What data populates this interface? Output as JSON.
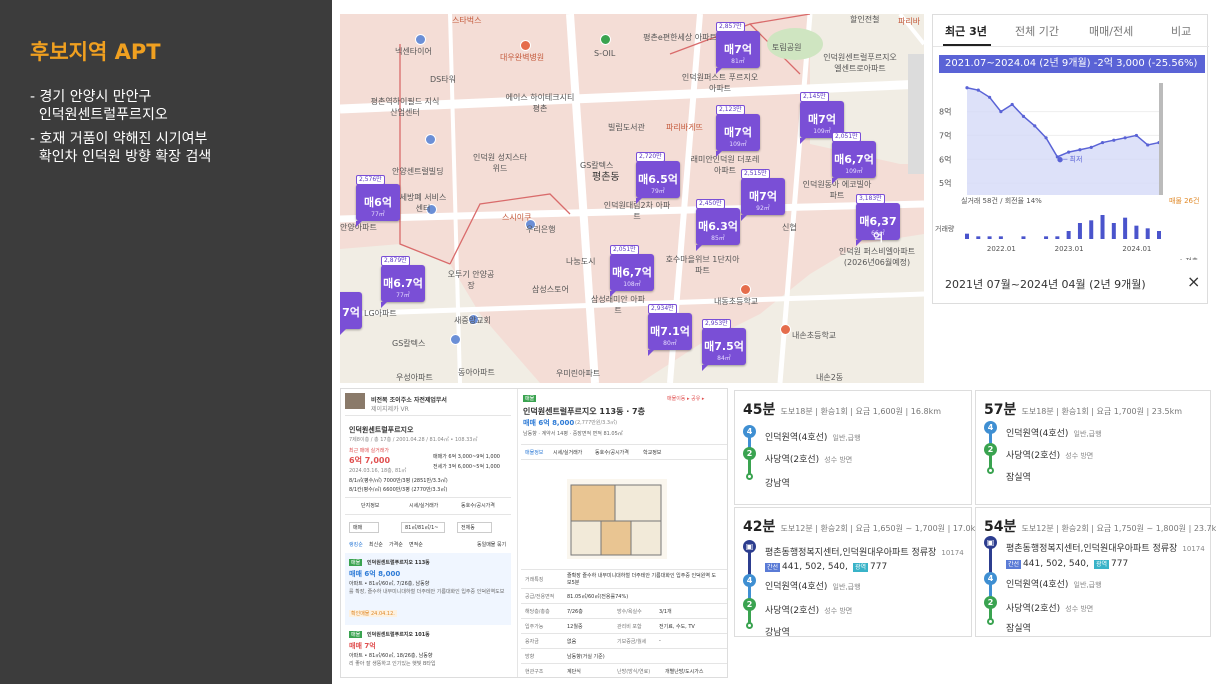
{
  "slide": {
    "title": "후보지역 APT",
    "bullets": [
      "- 경기 안양시 만안구\n  인덕원센트럴푸르지오",
      "- 호재 거품이 약해진 시기여부\n  확인차 인덕원 방향 확장 검색"
    ]
  },
  "map": {
    "labels": [
      {
        "text": "스타벅스"
      },
      {
        "text": "넥센타이어"
      },
      {
        "text": "대우완벽병원"
      },
      {
        "text": "S-OIL"
      },
      {
        "text": "평촌e편한세상 아파트"
      },
      {
        "text": "인덕원센트럴푸르지오 엘센트로아파트"
      },
      {
        "text": "DS타워"
      },
      {
        "text": "평촌역하이필드 지식산업센터"
      },
      {
        "text": "에이스 하이테크시티평촌"
      },
      {
        "text": "인덕원퍼스트 푸르지오아파트"
      },
      {
        "text": "빌립도서관"
      },
      {
        "text": "파리바게뜨"
      },
      {
        "text": "인덕원 성지스타위드"
      },
      {
        "text": "GS칼텍스"
      },
      {
        "text": "안양센트럴빌딩"
      },
      {
        "text": "평촌동"
      },
      {
        "text": "래미안인덕원 더포레아파트"
      },
      {
        "text": "인덕원동아 에코빌아파트"
      },
      {
        "text": "스시이쿠"
      },
      {
        "text": "우리은행"
      },
      {
        "text": "인덕원대림2차 아파트"
      },
      {
        "text": "신협"
      },
      {
        "text": "세방폐 서비스센터"
      },
      {
        "text": "안양아파트"
      },
      {
        "text": "오투기 안양공장"
      },
      {
        "text": "나눔도시"
      },
      {
        "text": "호수마을위브 1단지아파트"
      },
      {
        "text": "인덕원 퍼스비엘아파트 (2026년06월예정)"
      },
      {
        "text": "LG아파트"
      },
      {
        "text": "삼성스토어"
      },
      {
        "text": "새중앙교회"
      },
      {
        "text": "삼성래미안 아파트"
      },
      {
        "text": "내동초등학교"
      },
      {
        "text": "GS칼텍스"
      },
      {
        "text": "내손초등학교"
      },
      {
        "text": "우성아파트"
      },
      {
        "text": "동아아파트"
      },
      {
        "text": "우미린아파트"
      },
      {
        "text": "내손2동"
      },
      {
        "text": "토림공원"
      },
      {
        "text": "파리바"
      },
      {
        "text": "할인전철"
      }
    ],
    "markers": [
      {
        "price": "매7억",
        "top": "2,857만",
        "area": "81㎡"
      },
      {
        "price": "매7억",
        "top": "2,123만",
        "area": "109㎡"
      },
      {
        "price": "매7억",
        "top": "2,145만",
        "area": "109㎡"
      },
      {
        "price": "매6억",
        "top": "2,576만",
        "area": "77㎡"
      },
      {
        "price": "매6.5억",
        "top": "2,720만",
        "area": "79㎡"
      },
      {
        "price": "매6,7억",
        "top": "2,051만",
        "area": "109㎡"
      },
      {
        "price": "매7억",
        "top": "2,515만",
        "area": "92㎡"
      },
      {
        "price": "매6.3억",
        "top": "2,450만",
        "area": "85㎡"
      },
      {
        "price": "매6,37억",
        "top": "3,183만",
        "area": "66㎡"
      },
      {
        "price": "매6.7억",
        "top": "2,879만",
        "area": "77㎡"
      },
      {
        "price": "매6,7억",
        "top": "2,051만",
        "area": "108㎡"
      },
      {
        "price": "매7.1억",
        "top": "2,934만",
        "area": "80㎡"
      },
      {
        "price": "매7.5억",
        "top": "2,953만",
        "area": "84㎡"
      },
      {
        "price": "7억",
        "top": "",
        "area": ""
      }
    ]
  },
  "chart_panel": {
    "tabs": [
      "최근 3년",
      "전체 기간",
      "매매/전세",
      "비교"
    ],
    "active_tab": 0,
    "tooltip": "2021.07~2024.04 (2년 9개월)  -2억 3,000 (-25.56%)",
    "lowest_label": "최저",
    "trade_count": "실거래 58건 / 회전율 14%",
    "listing_count": "매물 26건",
    "volume_label": "거래량",
    "legend_label": "저층",
    "range_text": "2021년 07월~2024년 04월 (2년 9개월)",
    "close_icon": "×"
  },
  "chart_data": {
    "type": "line",
    "title": "",
    "y_ticks": [
      "8억",
      "7억",
      "6억",
      "5억"
    ],
    "ylim": [
      4.5,
      9.2
    ],
    "x_ticks": [
      "2022.01",
      "2023.01",
      "2024.01"
    ],
    "x": [
      "2021.07",
      "2021.09",
      "2021.11",
      "2022.01",
      "2022.03",
      "2022.05",
      "2022.07",
      "2022.09",
      "2022.11",
      "2023.01",
      "2023.03",
      "2023.05",
      "2023.07",
      "2023.09",
      "2023.11",
      "2024.01",
      "2024.03",
      "2024.04"
    ],
    "series": [
      {
        "values": [
          9.0,
          8.9,
          8.6,
          8.0,
          8.3,
          7.8,
          7.4,
          6.9,
          6.1,
          6.3,
          6.4,
          6.5,
          6.7,
          6.8,
          6.9,
          7.0,
          6.6,
          6.7
        ]
      }
    ],
    "volume": [
      2,
      1,
      1,
      1,
      0,
      1,
      0,
      1,
      1,
      3,
      6,
      7,
      9,
      6,
      8,
      5,
      4,
      3
    ],
    "colors": {
      "line": "#5a63d6",
      "fill": "#d5daf7",
      "volume": "#4a54cc",
      "tooltip": "#5a63d6"
    }
  },
  "listing": {
    "agency_name": "비전복 조이주소 자전제업무서",
    "agency_sub": "제이지제카 VR",
    "item_title": "인덕원센트럴푸르지오",
    "item_sub": "7제8이층 / 총 17층 / 2001.04.28 / 81.04㎡ • 108.33㎡",
    "recent_label": "최근 매매 실거래가",
    "recent_price": "6억 7,000",
    "recent_date": "2024.03.16, 18층, 81㎡",
    "stat1": "매매가 6억 3,000~9억 1,000",
    "stat2": "전세가 3억 6,000~5억 1,000",
    "unit1": "8/1㎡(평수/㎡) 7000만/3평 (2851만/3.3㎡)",
    "unit2": "8/1칸(평수/㎡) 6600만/3평 (2770만/3.3㎡)",
    "tabs": [
      "단지정보",
      "시세/실거래가",
      "동호수/공시가격"
    ],
    "filters": [
      "매매",
      "81㎡/81㎡/1~",
      "전체동"
    ],
    "sub_filters": [
      "랭킹순",
      "최신순",
      "가격순",
      "면적순",
      "동일매물 묶기"
    ],
    "entry1_tag": "매물",
    "entry1_title": "인덕원센트럴푸르지오 113동",
    "entry1_price": "매매 6억 8,000",
    "entry1_meta": "아파트 • 81㎡/60㎡, 7/26층, 남동향",
    "entry1_desc": "를 확장, 즐수하 내부미니대하철 더주테안 기름대화인 입주중 인덕원역도보",
    "entry1_agent": "확인매물 24.04.12.",
    "entry2_tag": "매물",
    "entry2_title": "인덕원센트럴푸르지오 101동",
    "entry2_price": "매매 7억",
    "entry2_meta": "아파트 • 81㎡/60㎡, 18/26층, 남동향",
    "entry2_desc": "리 좋아 잘 생뚱하고 인기있는 햇빛 B타입",
    "detail_tag": "매물",
    "detail_links": "매물이동 ▸ 공유 ▸",
    "detail_title": "인덕원센트럴푸르지오 113동 · 7층",
    "detail_price": "매매 6억 8,000",
    "detail_price_sub": "(2,777만원/3.3㎡)",
    "detail_meta": "남동향 · 계약서 14평 · 중장면적 면적 81.05㎡",
    "detail_tabs": [
      "매물정보",
      "시세/실거래가",
      "동호수/공시가격",
      "학교정보"
    ],
    "rows": [
      {
        "k": "거래특징",
        "v": "즐확장 즐수하 내부미니대하철 더주테안 기름대화인 입주중 인덕원역 도보5분"
      },
      {
        "k": "공급/전용면적",
        "v": "81.05㎡/60㎡(전용률74%)"
      },
      {
        "k": "해당층/총층",
        "v": "7/26층",
        "k2": "방수/욕실수",
        "v2": "3/1개"
      },
      {
        "k": "입주가능",
        "v": "12월중",
        "k2": "관리비 포함",
        "v2": "전기료, 수도, TV"
      },
      {
        "k": "융자금",
        "v": "없음",
        "k2": "기보증금/월세",
        "v2": "-"
      },
      {
        "k": "방향",
        "v": "남동향(거실 기준)"
      },
      {
        "k": "현관구조",
        "v": "계단식",
        "k2": "난방(방식/연료)",
        "v2": "개별난방/도시가스"
      }
    ]
  },
  "routes": [
    {
      "time": "45분",
      "meta": "도보18분 | 환승1회 | 요금 1,600원 | 16.8km",
      "steps": [
        {
          "icon": "4",
          "name": "인덕원역(4호선)",
          "extra": "일반,급행"
        },
        {
          "icon": "2",
          "name": "사당역(2호선)",
          "extra": "성수 방면"
        },
        {
          "icon": "end",
          "name": "강남역",
          "extra": ""
        }
      ]
    },
    {
      "time": "57분",
      "meta": "도보18분 | 환승1회 | 요금 1,700원 | 23.5km",
      "steps": [
        {
          "icon": "4",
          "name": "인덕원역(4호선)",
          "extra": "일반,급행"
        },
        {
          "icon": "2",
          "name": "사당역(2호선)",
          "extra": "성수 방면"
        },
        {
          "icon": "end",
          "name": "잠실역",
          "extra": ""
        }
      ]
    },
    {
      "time": "42분",
      "meta": "도보12분 | 환승2회 | 요금 1,650원 ~ 1,700원 | 17.0km",
      "steps": [
        {
          "icon": "bus",
          "name": "평촌동행정복지센터,인덕원대우아파트 정류장",
          "extra": "10174",
          "buses": "441, 502, 540,",
          "bus2": "777",
          "tag1": "간선",
          "tag2": "광역"
        },
        {
          "icon": "4",
          "name": "인덕원역(4호선)",
          "extra": "일반,급행"
        },
        {
          "icon": "2",
          "name": "사당역(2호선)",
          "extra": "성수 방면"
        },
        {
          "icon": "end",
          "name": "강남역",
          "extra": ""
        }
      ]
    },
    {
      "time": "54분",
      "meta": "도보12분 | 환승2회 | 요금 1,750원 ~ 1,800원 | 23.7km",
      "steps": [
        {
          "icon": "bus",
          "name": "평촌동행정복지센터,인덕원대우아파트 정류장",
          "extra": "10174",
          "buses": "441, 502, 540,",
          "bus2": "777",
          "tag1": "간선",
          "tag2": "광역"
        },
        {
          "icon": "4",
          "name": "인덕원역(4호선)",
          "extra": "일반,급행"
        },
        {
          "icon": "2",
          "name": "사당역(2호선)",
          "extra": "성수 방면"
        },
        {
          "icon": "end",
          "name": "잠실역",
          "extra": ""
        }
      ]
    }
  ]
}
